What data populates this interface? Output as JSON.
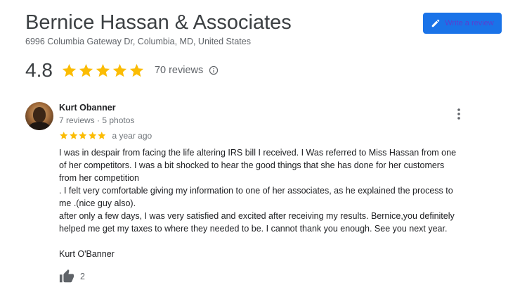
{
  "business": {
    "name": "Bernice Hassan & Associates",
    "address": "6996 Columbia Gateway Dr, Columbia, MD, United States"
  },
  "write_review": {
    "label": "Write a review",
    "icon": "pencil-icon"
  },
  "summary": {
    "rating": "4.8",
    "stars": 5,
    "review_count": "70 reviews",
    "info_icon": "info-icon"
  },
  "review": {
    "author": "Kurt Obanner",
    "author_meta": "7 reviews · 5 photos",
    "stars": 5,
    "date": "a year ago",
    "lines": [
      "I was in despair from facing the life altering IRS bill I received. I  Was referred to Miss Hassan from one",
      "of her competitors. I was a bit shocked to hear the good  things that she has done for her customers",
      "from her competition",
      ". I felt very comfortable giving my information to one of her associates, as he explained the process to",
      "me .(nice guy also).",
      "after only  a few days, I was very satisfied and excited after receiving my results. Bernice,you definitely",
      "helped me get my taxes to where they needed to be. I cannot thank you enough. See you next year.",
      "",
      "Kurt O'Banner"
    ],
    "likes": "2"
  },
  "colors": {
    "star": "#fbbc04",
    "button_bg": "#1a73e8",
    "button_text": "#5a3fd0",
    "secondary_text": "#5f6368"
  }
}
